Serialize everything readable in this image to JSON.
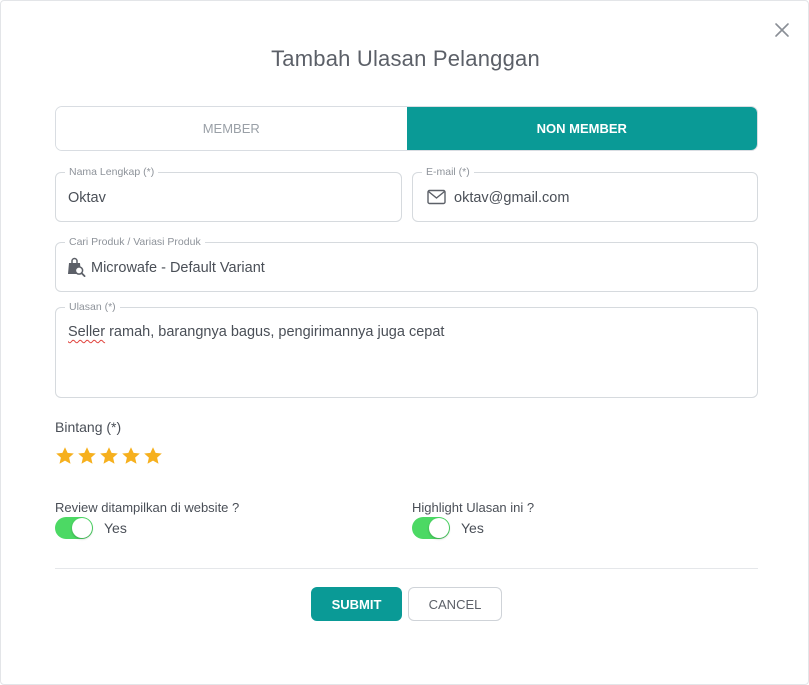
{
  "modal": {
    "title": "Tambah Ulasan Pelanggan",
    "close_icon": "close-icon"
  },
  "tabs": [
    {
      "label": "MEMBER",
      "active": false
    },
    {
      "label": "NON MEMBER",
      "active": true
    }
  ],
  "form": {
    "name": {
      "label": "Nama Lengkap (*)",
      "value": "Oktav"
    },
    "email": {
      "label": "E-mail (*)",
      "value": "oktav@gmail.com",
      "icon": "mail-icon"
    },
    "product": {
      "label": "Cari Produk / Variasi Produk",
      "value": "Microwafe - Default Variant",
      "icon": "product-search-icon"
    },
    "review": {
      "label": "Ulasan (*)",
      "value_first_word": "Seller",
      "value_rest": " ramah, barangnya bagus, pengirimannya juga cepat"
    },
    "rating": {
      "label": "Bintang (*)",
      "value": 5,
      "max": 5,
      "icon": "star-icon"
    },
    "show_on_website": {
      "label": "Review ditampilkan di website ?",
      "state_text": "Yes",
      "enabled": true
    },
    "highlight": {
      "label": "Highlight Ulasan ini ?",
      "state_text": "Yes",
      "enabled": true
    }
  },
  "buttons": {
    "submit": "SUBMIT",
    "cancel": "CANCEL"
  },
  "colors": {
    "accent": "#0a9a96",
    "toggle_on": "#4cd964",
    "star": "#f6b01e"
  }
}
